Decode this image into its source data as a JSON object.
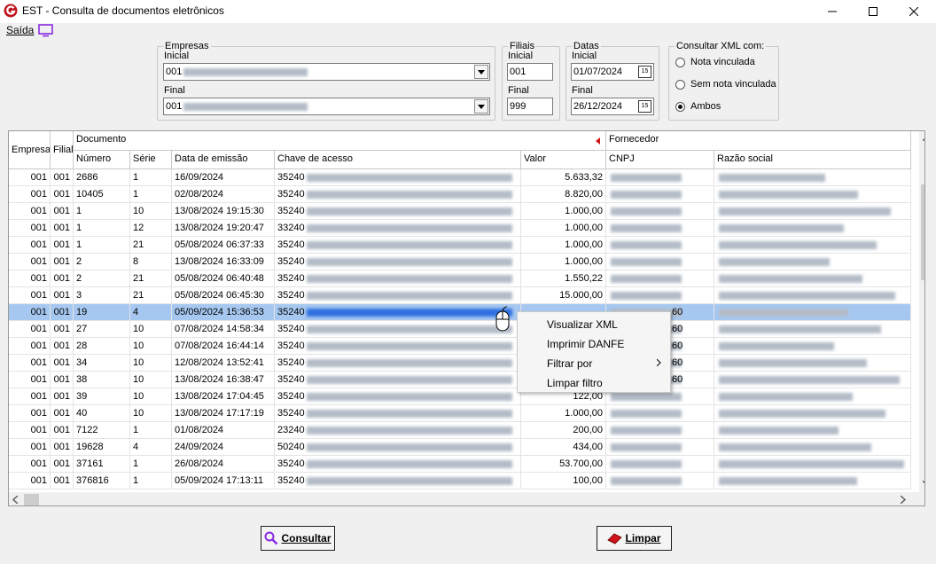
{
  "window": {
    "title": "EST - Consulta de documentos eletrônicos"
  },
  "menu": {
    "saida": "Saída"
  },
  "empresas": {
    "legend": "Empresas",
    "inicial_label": "Inicial",
    "inicial_value": "001",
    "final_label": "Final",
    "final_value": "001"
  },
  "filiais": {
    "legend": "Filiais",
    "inicial_label": "Inicial",
    "inicial_value": "001",
    "final_label": "Final",
    "final_value": "999"
  },
  "datas": {
    "legend": "Datas",
    "inicial_label": "Inicial",
    "inicial_value": "01/07/2024",
    "final_label": "Final",
    "final_value": "26/12/2024",
    "calendar_glyph": "15"
  },
  "xml": {
    "legend": "Consultar XML com:",
    "options": [
      "Nota vinculada",
      "Sem nota vinculada",
      "Ambos"
    ],
    "selected": "Ambos"
  },
  "grid": {
    "group_headers": {
      "empresa": "Empresa",
      "filial": "Filial",
      "documento": "Documento",
      "fornecedor": "Fornecedor"
    },
    "columns": [
      "Número",
      "Série",
      "Data de emissão",
      "Chave de acesso",
      "Valor",
      "CNPJ",
      "Razão social"
    ],
    "rows": [
      {
        "empresa": "001",
        "filial": "001",
        "numero": "2686",
        "serie": "1",
        "data": "16/09/2024",
        "chave": "35240",
        "valor": "5.633,32",
        "cnpj": ""
      },
      {
        "empresa": "001",
        "filial": "001",
        "numero": "10405",
        "serie": "1",
        "data": "02/08/2024",
        "chave": "35240",
        "valor": "8.820,00",
        "cnpj": ""
      },
      {
        "empresa": "001",
        "filial": "001",
        "numero": "1",
        "serie": "10",
        "data": "13/08/2024 19:15:30",
        "chave": "35240",
        "valor": "1.000,00",
        "cnpj": ""
      },
      {
        "empresa": "001",
        "filial": "001",
        "numero": "1",
        "serie": "12",
        "data": "13/08/2024 19:20:47",
        "chave": "33240",
        "valor": "1.000,00",
        "cnpj": ""
      },
      {
        "empresa": "001",
        "filial": "001",
        "numero": "1",
        "serie": "21",
        "data": "05/08/2024 06:37:33",
        "chave": "35240",
        "valor": "1.000,00",
        "cnpj": ""
      },
      {
        "empresa": "001",
        "filial": "001",
        "numero": "2",
        "serie": "8",
        "data": "13/08/2024 16:33:09",
        "chave": "35240",
        "valor": "1.000,00",
        "cnpj": ""
      },
      {
        "empresa": "001",
        "filial": "001",
        "numero": "2",
        "serie": "21",
        "data": "05/08/2024 06:40:48",
        "chave": "35240",
        "valor": "1.550,22",
        "cnpj": ""
      },
      {
        "empresa": "001",
        "filial": "001",
        "numero": "3",
        "serie": "21",
        "data": "05/08/2024 06:45:30",
        "chave": "35240",
        "valor": "15.000,00",
        "cnpj": ""
      },
      {
        "empresa": "001",
        "filial": "001",
        "numero": "19",
        "serie": "4",
        "data": "05/09/2024 15:36:53",
        "chave": "35240",
        "valor": "",
        "cnpj": "60"
      },
      {
        "empresa": "001",
        "filial": "001",
        "numero": "27",
        "serie": "10",
        "data": "07/08/2024 14:58:34",
        "chave": "35240",
        "valor": "",
        "cnpj": "60"
      },
      {
        "empresa": "001",
        "filial": "001",
        "numero": "28",
        "serie": "10",
        "data": "07/08/2024 16:44:14",
        "chave": "35240",
        "valor": "",
        "cnpj": "60"
      },
      {
        "empresa": "001",
        "filial": "001",
        "numero": "34",
        "serie": "10",
        "data": "12/08/2024 13:52:41",
        "chave": "35240",
        "valor": "",
        "cnpj": "60"
      },
      {
        "empresa": "001",
        "filial": "001",
        "numero": "38",
        "serie": "10",
        "data": "13/08/2024 16:38:47",
        "chave": "35240",
        "valor": "",
        "cnpj": "60"
      },
      {
        "empresa": "001",
        "filial": "001",
        "numero": "39",
        "serie": "10",
        "data": "13/08/2024 17:04:45",
        "chave": "35240",
        "valor": "122,00",
        "cnpj": ""
      },
      {
        "empresa": "001",
        "filial": "001",
        "numero": "40",
        "serie": "10",
        "data": "13/08/2024 17:17:19",
        "chave": "35240",
        "valor": "1.000,00",
        "cnpj": ""
      },
      {
        "empresa": "001",
        "filial": "001",
        "numero": "7122",
        "serie": "1",
        "data": "01/08/2024",
        "chave": "23240",
        "valor": "200,00",
        "cnpj": ""
      },
      {
        "empresa": "001",
        "filial": "001",
        "numero": "19628",
        "serie": "4",
        "data": "24/09/2024",
        "chave": "50240",
        "valor": "434,00",
        "cnpj": ""
      },
      {
        "empresa": "001",
        "filial": "001",
        "numero": "37161",
        "serie": "1",
        "data": "26/08/2024",
        "chave": "35240",
        "valor": "53.700,00",
        "cnpj": ""
      },
      {
        "empresa": "001",
        "filial": "001",
        "numero": "376816",
        "serie": "1",
        "data": "05/09/2024 17:13:11",
        "chave": "35240",
        "valor": "100,00",
        "cnpj": ""
      }
    ],
    "selected_row": 8
  },
  "context_menu": {
    "items": [
      "Visualizar XML",
      "Imprimir DANFE",
      "Filtrar por",
      "Limpar filtro"
    ]
  },
  "buttons": {
    "consultar": "Consultar",
    "limpar": "Limpar"
  },
  "colors": {
    "selection": "#a6c8f0",
    "accent_purple": "#8a2be2",
    "logo_red": "#c0141c"
  }
}
